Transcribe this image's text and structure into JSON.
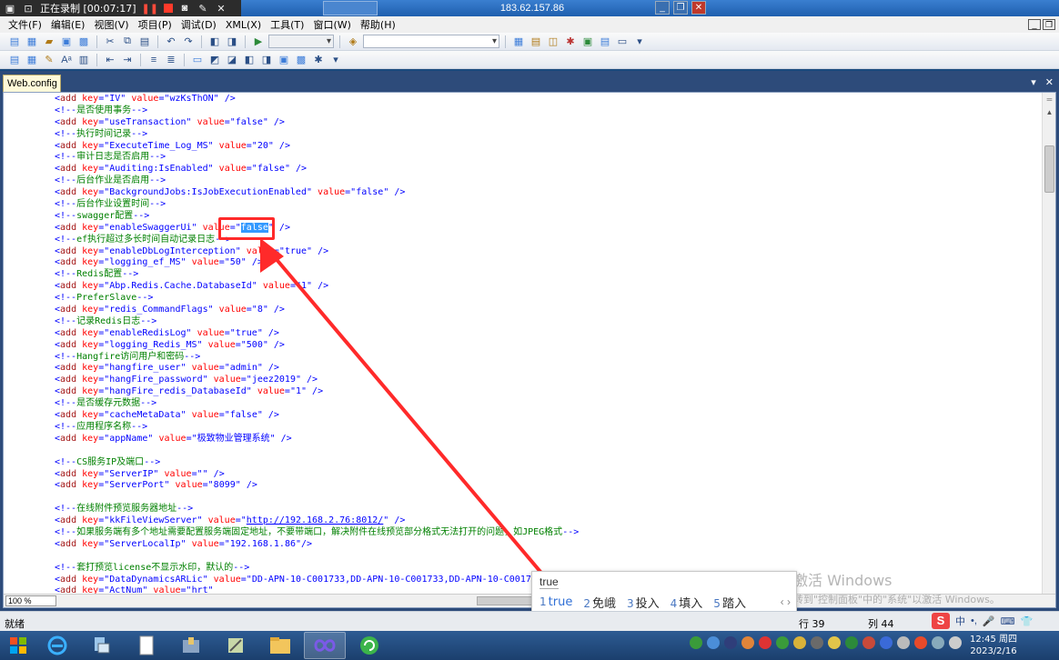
{
  "remote": {
    "recording_label": "正在录制 [00:07:17]",
    "host": "183.62.157.86"
  },
  "menu": [
    "文件(F)",
    "编辑(E)",
    "视图(V)",
    "项目(P)",
    "调试(D)",
    "XML(X)",
    "工具(T)",
    "窗口(W)",
    "帮助(H)"
  ],
  "document": {
    "tab_label": "Web.config",
    "zoom": "100 %",
    "lines": [
      {
        "type": "add",
        "key": "IV",
        "value": "wzKsThON"
      },
      {
        "type": "comment",
        "text": "是否使用事务"
      },
      {
        "type": "add",
        "key": "useTransaction",
        "value": "false"
      },
      {
        "type": "comment",
        "text": "执行时间记录"
      },
      {
        "type": "add",
        "key": "ExecuteTime_Log_MS",
        "value": "20"
      },
      {
        "type": "comment",
        "text": "审计日志是否启用"
      },
      {
        "type": "add",
        "key": "Auditing:IsEnabled",
        "value": "false"
      },
      {
        "type": "comment",
        "text": "后台作业是否启用"
      },
      {
        "type": "add",
        "key": "BackgroundJobs:IsJobExecutionEnabled",
        "value": "false"
      },
      {
        "type": "comment",
        "text": "后台作业设置时间"
      },
      {
        "type": "comment",
        "text": "swagger配置"
      },
      {
        "type": "add",
        "key": "enableSwaggerUi",
        "value": "false",
        "selected": true
      },
      {
        "type": "comment",
        "text": "ef执行超过多长时间自动记录日志"
      },
      {
        "type": "add",
        "key": "enableDbLogInterception",
        "value": "true"
      },
      {
        "type": "add",
        "key": "logging_ef_MS",
        "value": "50"
      },
      {
        "type": "comment",
        "text": "Redis配置"
      },
      {
        "type": "add",
        "key": "Abp.Redis.Cache.DatabaseId",
        "value": "1"
      },
      {
        "type": "comment",
        "text": "PreferSlave"
      },
      {
        "type": "add",
        "key": "redis_CommandFlags",
        "value": "8"
      },
      {
        "type": "comment",
        "text": "记录Redis日志"
      },
      {
        "type": "add",
        "key": "enableRedisLog",
        "value": "true"
      },
      {
        "type": "add",
        "key": "logging_Redis_MS",
        "value": "500"
      },
      {
        "type": "comment",
        "text": "Hangfire访问用户和密码"
      },
      {
        "type": "add",
        "key": "hangfire_user",
        "value": "admin"
      },
      {
        "type": "add",
        "key": "hangFire_password",
        "value": "jeez2019"
      },
      {
        "type": "add",
        "key": "hangFire_redis_DatabaseId",
        "value": "1"
      },
      {
        "type": "comment",
        "text": "是否缓存元数据"
      },
      {
        "type": "add",
        "key": "cacheMetaData",
        "value": "false"
      },
      {
        "type": "comment",
        "text": "应用程序名称"
      },
      {
        "type": "add",
        "key": "appName",
        "value": "极致物业管理系统"
      },
      {
        "type": "blank"
      },
      {
        "type": "comment",
        "text": "CS服务IP及端口"
      },
      {
        "type": "add",
        "key": "ServerIP",
        "value": ""
      },
      {
        "type": "add",
        "key": "ServerPort",
        "value": "8099"
      },
      {
        "type": "blank"
      },
      {
        "type": "comment",
        "text": "在线附件预览服务器地址"
      },
      {
        "type": "add",
        "key": "kkFileViewServer",
        "value": "http://192.168.2.76:8012/",
        "link": true
      },
      {
        "type": "comment",
        "text": "如果服务端有多个地址需要配置服务端固定地址，不要带端口，解决附件在线预览部分格式无法打开的问题，如JPEG格式"
      },
      {
        "type": "add",
        "key": "ServerLocalIp",
        "value": "192.168.1.86",
        "nospace": true
      },
      {
        "type": "blank"
      },
      {
        "type": "comment",
        "text": "套打预览license不显示水印，默认的"
      },
      {
        "type": "add",
        "key": "DataDynamicsARLic",
        "value": "DD-APN-10-C001733,DD-APN-10-C001733,DD-APN-10-C001733,XY6",
        "open": true
      },
      {
        "type": "add",
        "key": "ActNum",
        "value": "hrt",
        "partial": true
      }
    ]
  },
  "ime": {
    "input": "true",
    "candidates": [
      {
        "num": "1",
        "text": "true"
      },
      {
        "num": "2",
        "text": "免峨"
      },
      {
        "num": "3",
        "text": "投入"
      },
      {
        "num": "4",
        "text": "填入"
      },
      {
        "num": "5",
        "text": "踏入"
      }
    ]
  },
  "watermark": {
    "line1": "激活 Windows",
    "line2": "转到\"控制面板\"中的\"系统\"以激活 Windows。"
  },
  "status": {
    "ready": "就绪",
    "row": "行 39",
    "col": "列 44"
  },
  "tray": {
    "lang": "中",
    "time": "12:45 周四",
    "date": "2023/2/16"
  },
  "colors": {
    "annotation": "#ff2a2a",
    "selection": "#3399ff",
    "xml_tag": "#0000ff",
    "xml_attr": "#ff0000",
    "xml_comment": "#008000"
  }
}
